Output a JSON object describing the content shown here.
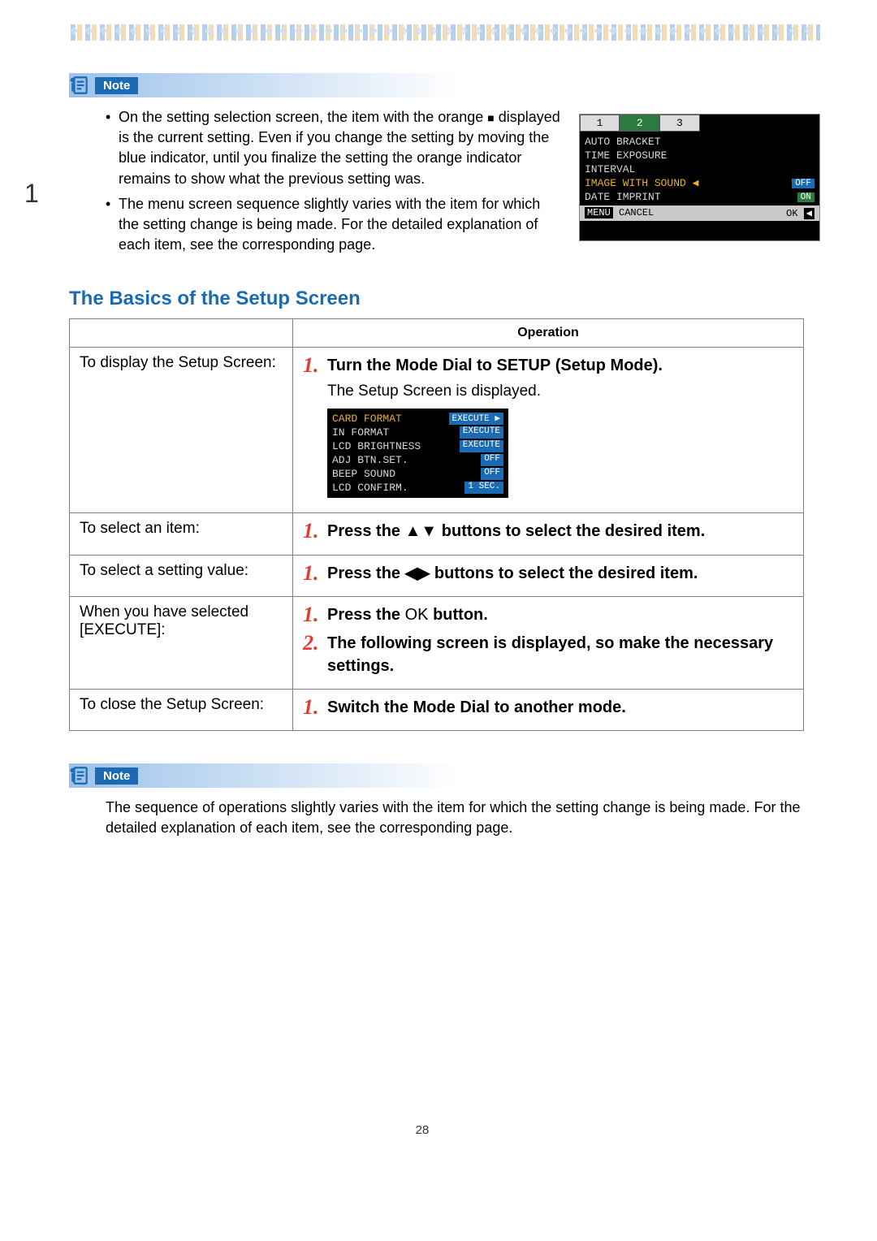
{
  "page_number": "28",
  "side_number": "1",
  "decor": "❖ ❖ ❖ ❖ ❖ ❖ ❖ ❖ ❖ ❖ ❖ ❖ ❖ ❖ ❖ ❖ ❖ ❖ ❖ ❖ ❖ ❖ ❖ ❖ ❖ ❖ ❖ ❖ ❖ ❖ ❖ ❖ ❖ ❖ ❖ ❖ ❖ ❖ ❖ ❖ ❖ ❖ ❖ ❖ ❖ ❖ ❖ ❖ ❖ ❖ ❖ ❖ ❖ ❖ ❖ ❖ ❖ ❖",
  "notes": {
    "label": "Note",
    "first": {
      "item1_a": "On the setting selection screen, the item with the orange ",
      "item1_b": " displayed is the current setting. Even if you change the setting by moving the blue indicator, until you finalize the setting the orange indicator remains to show what the previous setting was.",
      "item2": "The menu screen sequence slightly varies with the item for which the setting change is being made. For the detailed explanation of each item, see the corresponding page."
    },
    "second": "The sequence of operations slightly varies with the item for which the setting change is being made. For the detailed explanation of each item, see the corresponding page."
  },
  "camera_screen": {
    "tabs": [
      "1",
      "2",
      "3"
    ],
    "items": [
      {
        "label": "AUTO BRACKET",
        "val": ""
      },
      {
        "label": "TIME EXPOSURE",
        "val": ""
      },
      {
        "label": "INTERVAL",
        "val": ""
      },
      {
        "label": "IMAGE WITH SOUND",
        "val": "OFF",
        "hl": true,
        "arrow": "◀"
      },
      {
        "label": "DATE IMPRINT",
        "val": "ON"
      }
    ],
    "footer_left_a": "MENU",
    "footer_left_b": "CANCEL",
    "footer_right_a": "OK",
    "footer_right_b": "◀"
  },
  "section_title": "The Basics of the Setup Screen",
  "table": {
    "header_left": "",
    "header_right": "Operation",
    "rows": {
      "display": {
        "left": "To display the Setup Screen:",
        "num": "1.",
        "text_a": "Turn the Mode Dial to ",
        "text_b": "SETUP",
        "text_c": " (Setup Mode).",
        "sub": "The Setup Screen is displayed."
      },
      "select_item": {
        "left": "To select an item:",
        "num": "1.",
        "text_a": "Press the ",
        "text_b": " buttons to select the desired item."
      },
      "select_value": {
        "left": "To select a setting value:",
        "num": "1.",
        "text_a": "Press the ",
        "text_b": " buttons to select the desired item."
      },
      "execute": {
        "left": "When you have selected [EXECUTE]:",
        "num1": "1.",
        "text1_a": "Press the ",
        "text1_b": "OK",
        "text1_c": " button.",
        "num2": "2.",
        "text2": "The following screen is displayed,  so make the necessary settings."
      },
      "close": {
        "left": "To close the Setup Screen:",
        "num": "1.",
        "text": "Switch the Mode Dial to another mode."
      }
    }
  },
  "setup_screen": {
    "rows": [
      {
        "label": "CARD FORMAT",
        "val": "EXECUTE",
        "hl": true,
        "arrow": "▶"
      },
      {
        "label": "IN FORMAT",
        "val": "EXECUTE"
      },
      {
        "label": "LCD BRIGHTNESS",
        "val": "EXECUTE"
      },
      {
        "label": "ADJ BTN.SET.",
        "val": "OFF"
      },
      {
        "label": "BEEP SOUND",
        "val": "OFF"
      },
      {
        "label": "LCD CONFIRM.",
        "val": "1 SEC."
      }
    ]
  }
}
